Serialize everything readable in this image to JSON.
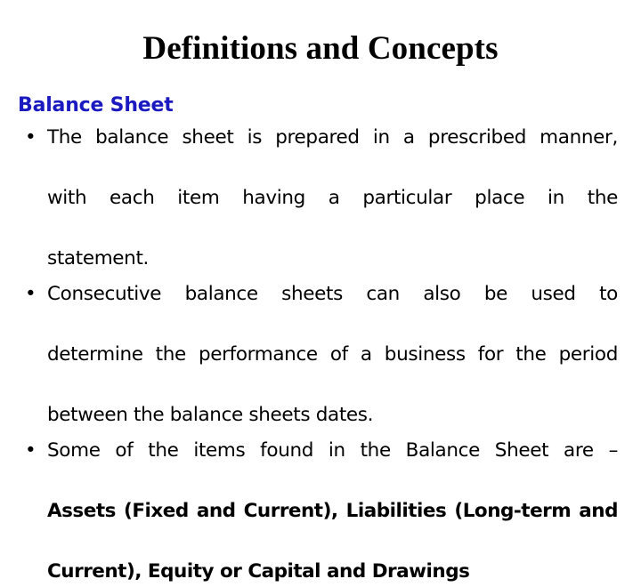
{
  "slide": {
    "title": "Definitions and Concepts",
    "background_color": "#FFFFFF",
    "heading": {
      "text": "Balance Sheet",
      "color": "#1A1AC0"
    },
    "bullet_marker": "•",
    "bullets": [
      {
        "id": "bullet-1",
        "lines": [
          "The balance sheet is prepared in a prescribed manner,",
          "with each item having a particular place in the",
          "statement."
        ],
        "full_text": "The balance sheet is prepared in a prescribed manner, with each item having a particular place in the statement.",
        "bold": false
      },
      {
        "id": "bullet-2",
        "lines": [
          "Consecutive balance sheets can also be used to",
          "determine the performance of a business for the period",
          "between the balance sheets dates."
        ],
        "full_text": "Consecutive balance sheets can also be used to determine the performance of a business for the period between the balance sheets dates.",
        "bold": false
      },
      {
        "id": "bullet-3",
        "lines": [
          "Some of the items found in the Balance Sheet are –",
          "Assets (Fixed and Current), Liabilities (Long-term and",
          "Current), Equity or Capital and Drawings"
        ],
        "full_text": "Some of the items found in the Balance Sheet are – Assets (Fixed and Current), Liabilities (Long-term and Current), Equity or Capital and Drawings",
        "plain_part": "Some of the items found in the Balance Sheet are –",
        "bold_part_line_1": "Assets (Fixed and Current), Liabilities (Long-term and",
        "bold_part_line_2": "Current), Equity or Capital and Drawings",
        "bold": true
      }
    ]
  }
}
